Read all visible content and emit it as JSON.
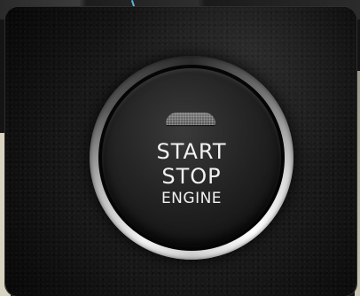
{
  "button": {
    "line1": "START",
    "line2": "STOP",
    "line3": "ENGINE"
  },
  "colors": {
    "label": "#f2f2f2",
    "leather": "#141414",
    "chrome": "#d9d9d9",
    "indicator": "#777777",
    "top_accent": "#5ab7e0"
  }
}
